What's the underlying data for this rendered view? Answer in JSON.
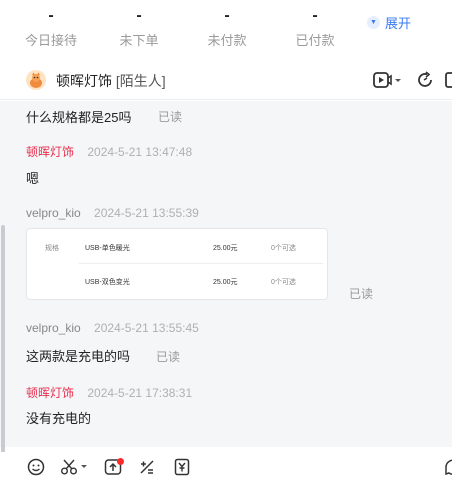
{
  "stats": [
    {
      "value": "-",
      "label": "今日接待"
    },
    {
      "value": "-",
      "label": "未下单"
    },
    {
      "value": "-",
      "label": "未付款"
    },
    {
      "value": "-",
      "label": "已付款"
    }
  ],
  "expand_label": "展开",
  "chat": {
    "shop_name": "顿晖灯饰",
    "tag": "[陌生人]"
  },
  "messages": {
    "m1_text": "什么规格都是25吗",
    "m1_read": "已读",
    "m2_sender": "顿晖灯饰",
    "m2_time": "2024-5-21 13:47:48",
    "m2_text": "嗯",
    "m3_sender": "velpro_kio",
    "m3_time": "2024-5-21 13:55:39",
    "m3_read": "已读",
    "card": {
      "row1": {
        "spec": "规格",
        "name": "USB-单色暖光",
        "price": "25.00元",
        "qty": "0个可选"
      },
      "row2": {
        "name": "USB-双色变光",
        "price": "25.00元",
        "qty": "0个可选"
      }
    },
    "m4_sender": "velpro_kio",
    "m4_time": "2024-5-21 13:55:45",
    "m4_text": "这两款是充电的吗",
    "m4_read": "已读",
    "m5_sender": "顿晖灯饰",
    "m5_time": "2024-5-21 17:38:31",
    "m5_text": "没有充电的"
  },
  "colors": {
    "accent": "#3a7bf0",
    "shop_name_red": "#e8304f",
    "background": "#f5f6f8"
  },
  "icons": {
    "header": [
      "video-icon",
      "refresh-icon",
      "more-icon"
    ],
    "toolbar": [
      "emoji-icon",
      "scissors-icon",
      "upload-icon",
      "calculator-icon",
      "coupon-icon",
      "chat-icon"
    ]
  }
}
